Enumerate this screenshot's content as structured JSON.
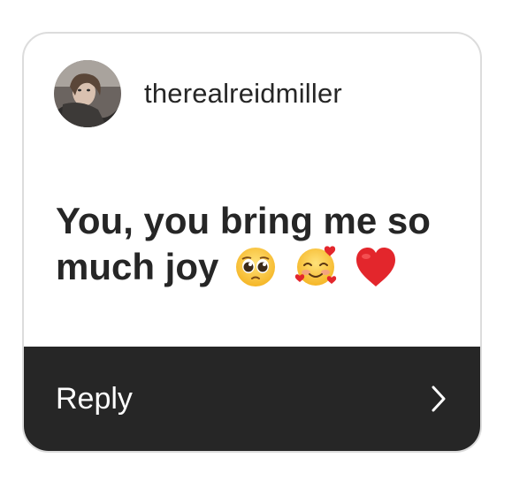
{
  "story_reply": {
    "username": "therealreidmiller",
    "avatar": "profile-photo",
    "message_text": "You, you bring me so much joy",
    "emojis": [
      "pleading-face-emoji",
      "smiling-face-with-hearts-emoji",
      "red-heart-emoji"
    ],
    "reply_label": "Reply",
    "chevron": "chevron-right-icon"
  },
  "colors": {
    "card_background": "#ffffff",
    "card_border": "#dcdcdc",
    "text_primary": "#262626",
    "reply_bar_background": "#262626",
    "reply_text": "#ffffff"
  }
}
